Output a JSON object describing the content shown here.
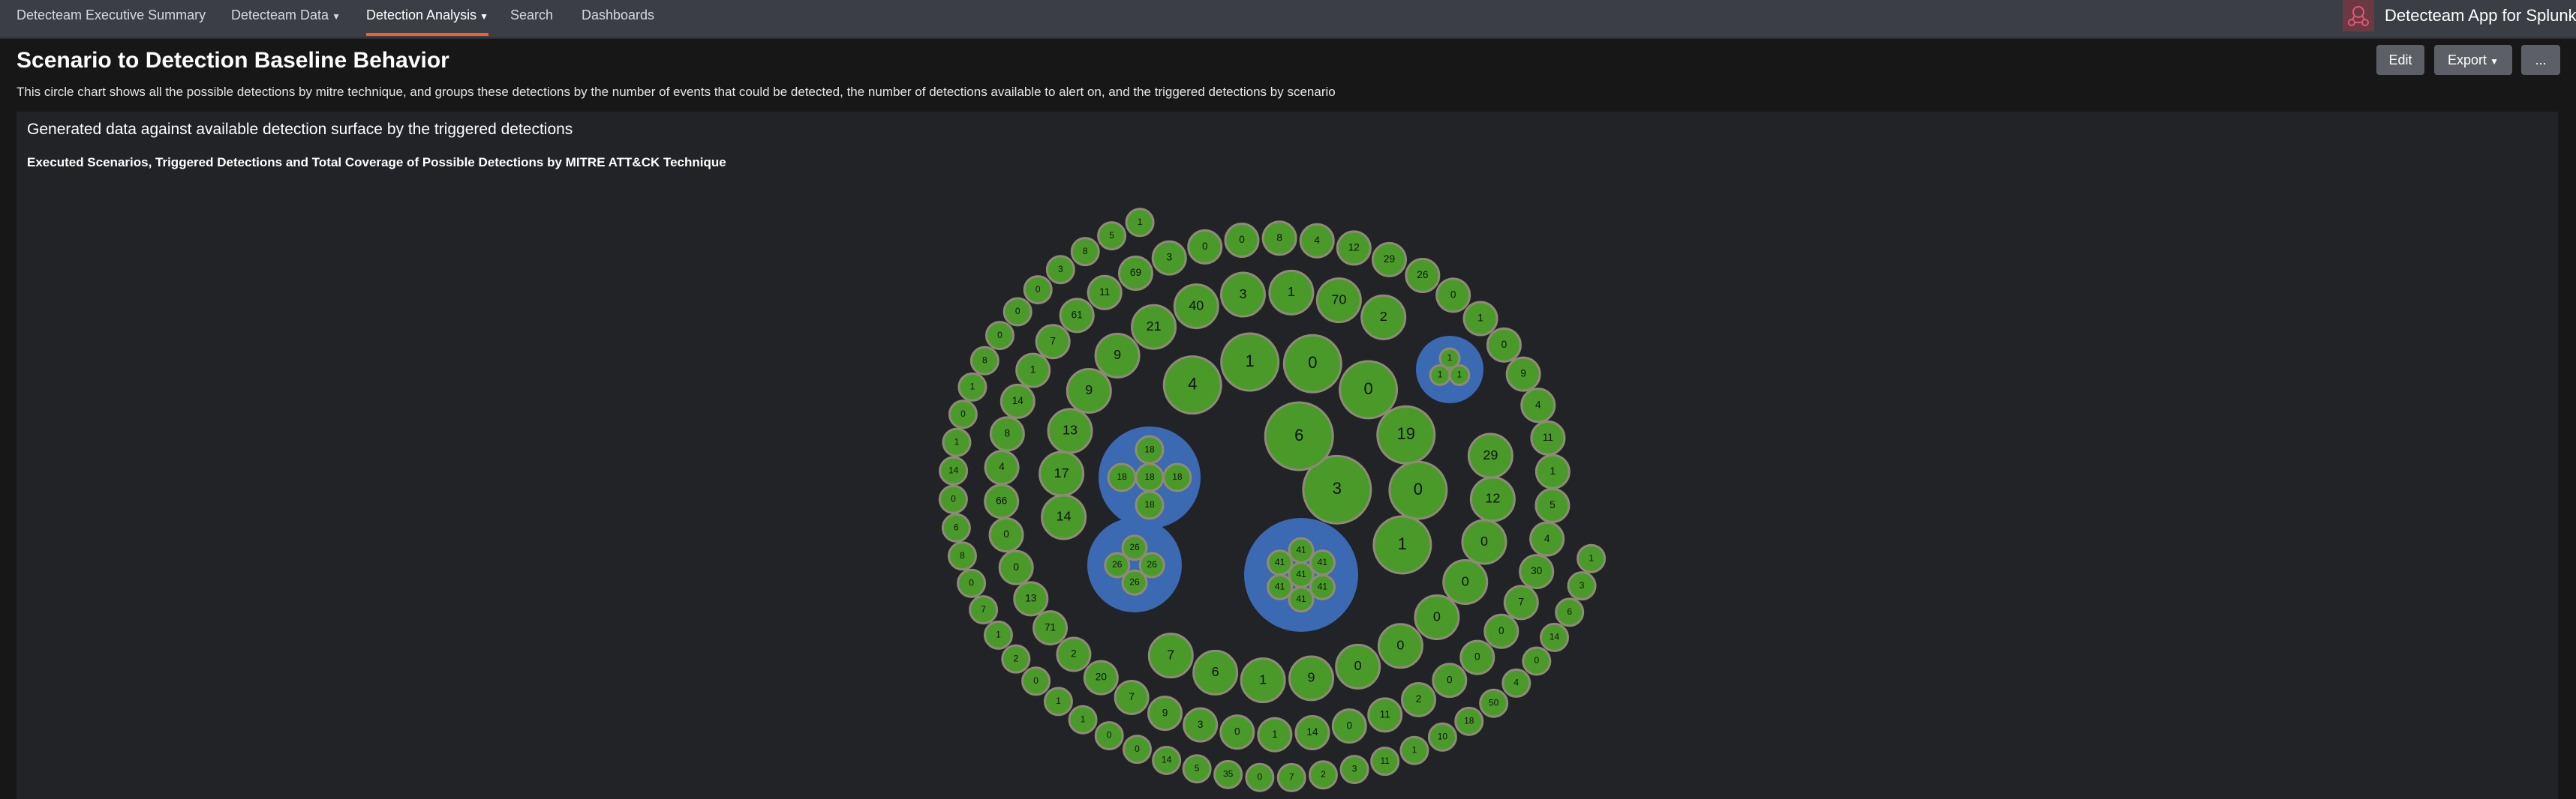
{
  "nav": {
    "items": [
      {
        "label": "Detecteam Executive Summary",
        "dropdown": false,
        "active": false
      },
      {
        "label": "Detecteam Data",
        "dropdown": true,
        "active": false
      },
      {
        "label": "Detection Analysis",
        "dropdown": true,
        "active": true
      },
      {
        "label": "Search",
        "dropdown": false,
        "active": false
      },
      {
        "label": "Dashboards",
        "dropdown": false,
        "active": false
      }
    ],
    "app_title": "Detecteam App for Splunk",
    "logo_icon": "detecteam-logo-icon"
  },
  "page": {
    "title": "Scenario to Detection Baseline Behavior",
    "description": "This circle chart shows all the possible detections by mitre technique, and groups these detections by the number of events that could be detected, the number of detections available to alert on, and the triggered detections by scenario"
  },
  "toolbar": {
    "edit_label": "Edit",
    "export_label": "Export",
    "more_label": "..."
  },
  "panel": {
    "title": "Generated data against available detection surface by the triggered detections"
  },
  "colors": {
    "accent": "#f06028",
    "bubble_fill": "#4a9a2a",
    "bubble_border": "#8f8a78",
    "group_fill": "#3b69b2"
  },
  "chart_data": {
    "type": "packed-bubble",
    "title": "Executed Scenarios, Triggered Detections and Total Coverage of Possible Detections by MITRE ATT&CK Technique",
    "groups": [
      {
        "members": [
          "18",
          "18",
          "18",
          "18",
          "18"
        ]
      },
      {
        "members": [
          "26",
          "26",
          "26",
          "26"
        ]
      },
      {
        "members": [
          "41",
          "41",
          "41",
          "41",
          "41",
          "41",
          "41"
        ]
      },
      {
        "members": [
          "1",
          "1",
          "1"
        ]
      }
    ],
    "values": [
      "3",
      "6",
      "0",
      "1",
      "4",
      "1",
      "0",
      "0",
      "19",
      "0",
      "0",
      "0",
      "0",
      "0",
      "9",
      "1",
      "6",
      "7",
      "14",
      "17",
      "13",
      "9",
      "9",
      "21",
      "40",
      "3",
      "1",
      "70",
      "2",
      "29",
      "12",
      "30",
      "7",
      "0",
      "0",
      "0",
      "2",
      "11",
      "0",
      "14",
      "1",
      "0",
      "3",
      "9",
      "7",
      "20",
      "2",
      "71",
      "13",
      "0",
      "0",
      "66",
      "4",
      "8",
      "14",
      "1",
      "7",
      "61",
      "11",
      "69",
      "3",
      "0",
      "0",
      "8",
      "4",
      "12",
      "29",
      "26",
      "0",
      "1",
      "0",
      "9",
      "4",
      "11",
      "1",
      "5",
      "4",
      "1",
      "3",
      "6",
      "14",
      "0",
      "4",
      "50",
      "18",
      "10",
      "1",
      "11",
      "3",
      "2",
      "7",
      "0",
      "35",
      "5",
      "14",
      "0",
      "0",
      "1",
      "1",
      "0",
      "2",
      "1",
      "7",
      "0",
      "8",
      "6",
      "0",
      "14",
      "1",
      "0",
      "1",
      "8",
      "0",
      "0",
      "0",
      "3",
      "8",
      "5",
      "1"
    ]
  }
}
